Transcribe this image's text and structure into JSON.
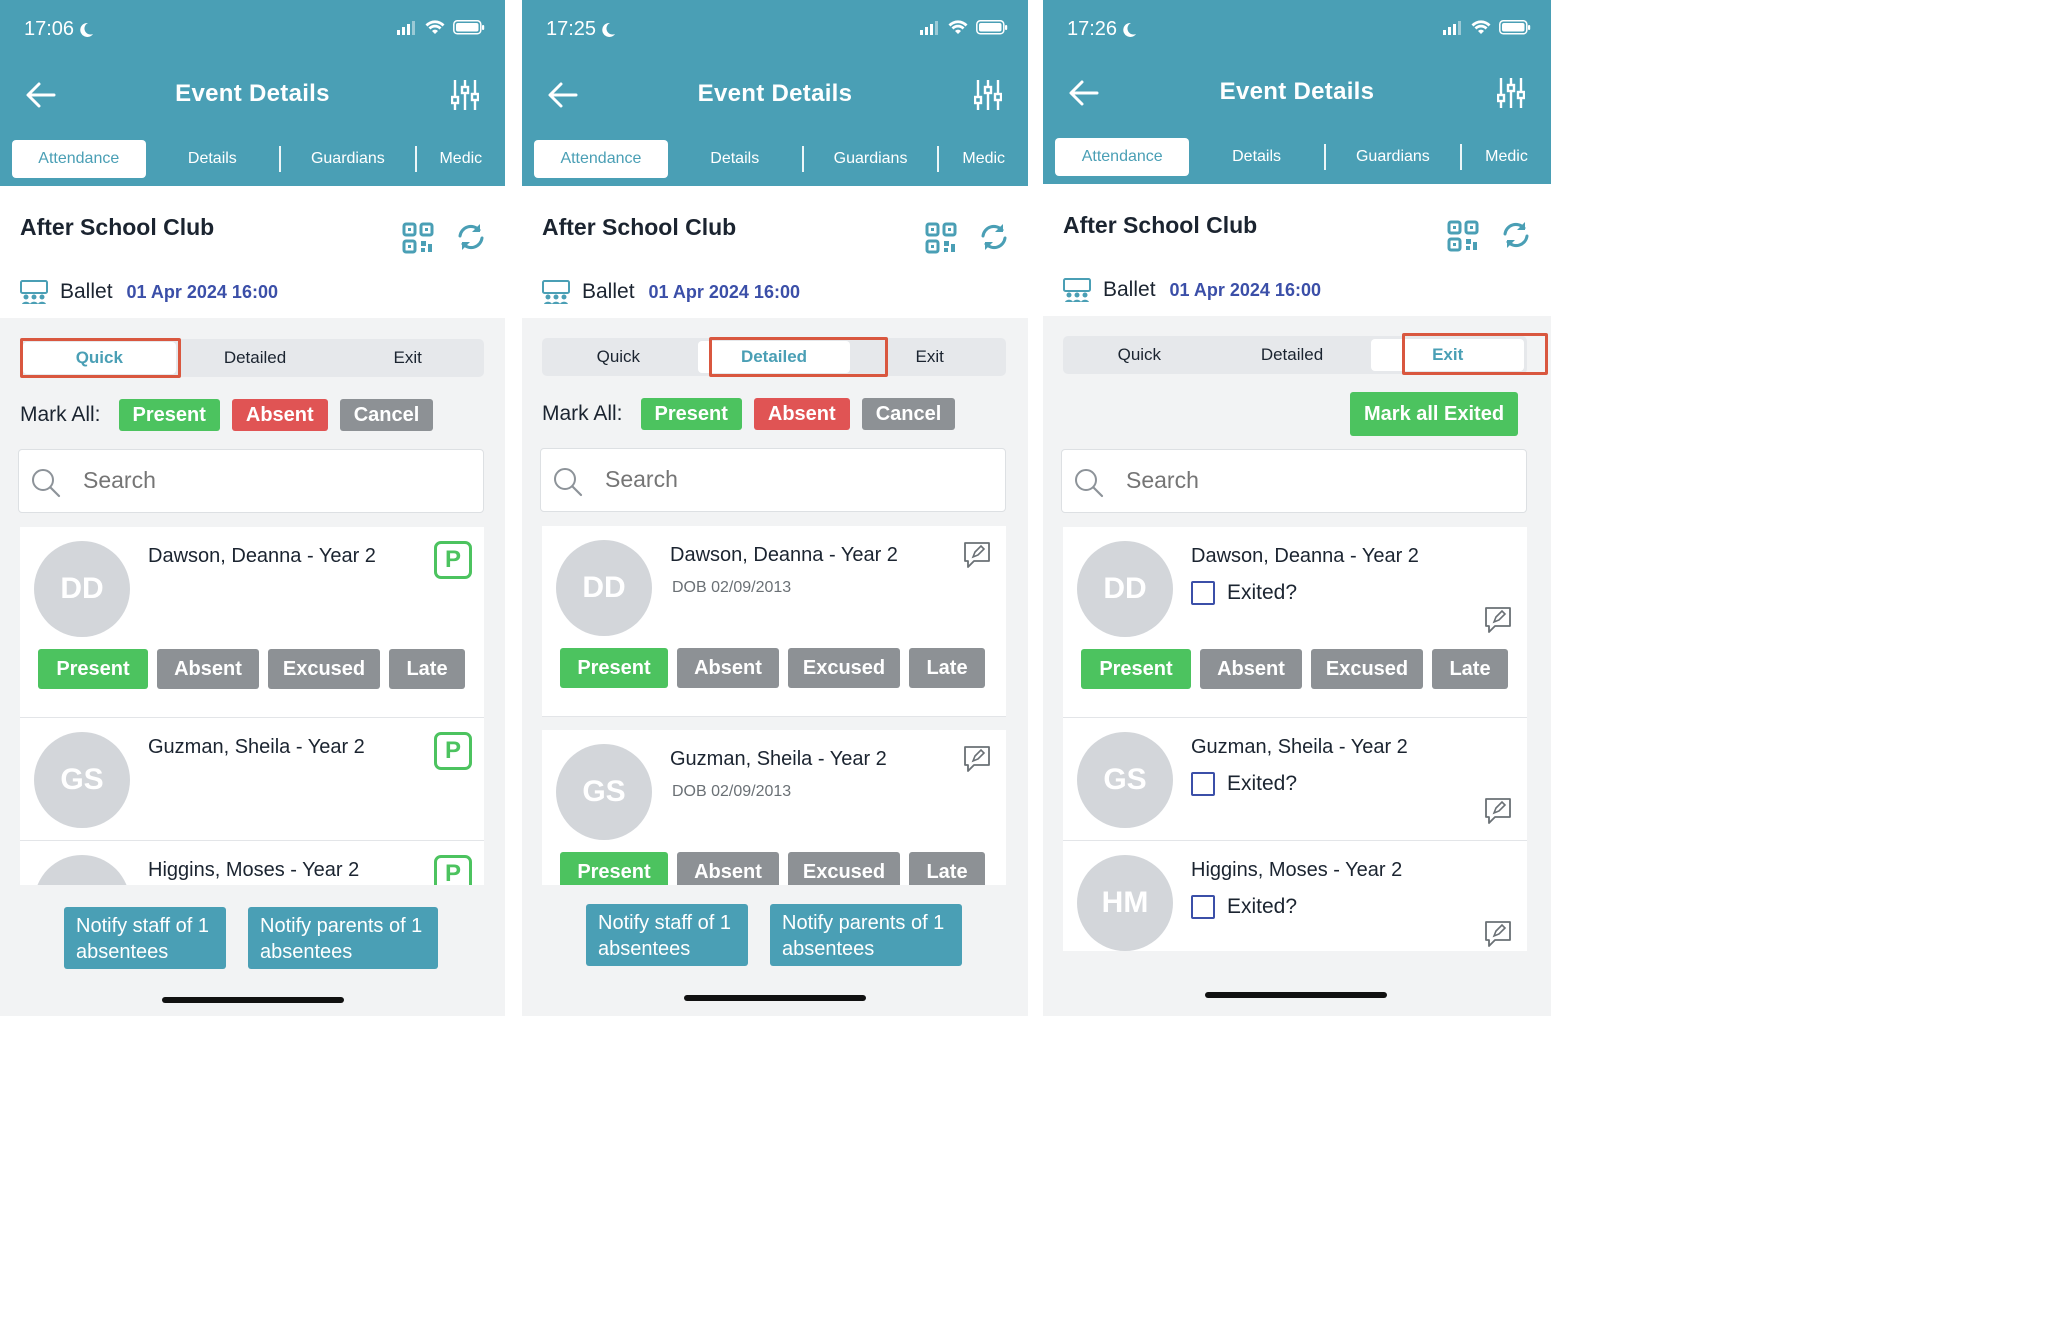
{
  "screens": [
    {
      "status_time": "17:06",
      "title": "Event Details",
      "tabs": [
        "Attendance",
        "Details",
        "Guardians",
        "Medic"
      ],
      "club_name": "After School Club",
      "activity": "Ballet",
      "datetime": "01 Apr 2024 16:00",
      "modes": [
        "Quick",
        "Detailed",
        "Exit"
      ],
      "mark_all_label": "Mark All:",
      "mark_all_buttons": [
        "Present",
        "Absent",
        "Cancel"
      ],
      "search_placeholder": "Search",
      "students": [
        {
          "initials": "DD",
          "name": "Dawson, Deanna - Year 2",
          "badge": "P",
          "buttons": [
            "Present",
            "Absent",
            "Excused",
            "Late"
          ]
        },
        {
          "initials": "GS",
          "name": "Guzman, Sheila - Year 2",
          "badge": "P"
        },
        {
          "initials": "",
          "name": "Higgins, Moses - Year 2",
          "badge": "P"
        }
      ],
      "notify_staff": "Notify staff of 1 absentees",
      "notify_parents": "Notify parents of 1 absentees"
    },
    {
      "status_time": "17:25",
      "title": "Event Details",
      "tabs": [
        "Attendance",
        "Details",
        "Guardians",
        "Medic"
      ],
      "club_name": "After School Club",
      "activity": "Ballet",
      "datetime": "01 Apr 2024 16:00",
      "modes": [
        "Quick",
        "Detailed",
        "Exit"
      ],
      "mark_all_label": "Mark All:",
      "mark_all_buttons": [
        "Present",
        "Absent",
        "Cancel"
      ],
      "search_placeholder": "Search",
      "students": [
        {
          "initials": "DD",
          "name": "Dawson, Deanna - Year 2",
          "dob": "DOB 02/09/2013",
          "buttons": [
            "Present",
            "Absent",
            "Excused",
            "Late"
          ]
        },
        {
          "initials": "GS",
          "name": "Guzman, Sheila - Year 2",
          "dob": "DOB 02/09/2013",
          "buttons": [
            "Present",
            "Absent",
            "Excused",
            "Late"
          ]
        }
      ],
      "notify_staff": "Notify staff of 1 absentees",
      "notify_parents": "Notify parents of 1 absentees"
    },
    {
      "status_time": "17:26",
      "title": "Event Details",
      "tabs": [
        "Attendance",
        "Details",
        "Guardians",
        "Medic"
      ],
      "club_name": "After School Club",
      "activity": "Ballet",
      "datetime": "01 Apr 2024 16:00",
      "modes": [
        "Quick",
        "Detailed",
        "Exit"
      ],
      "mark_all_exited": "Mark all Exited",
      "search_placeholder": "Search",
      "exited_label": "Exited?",
      "students": [
        {
          "initials": "DD",
          "name": "Dawson, Deanna - Year 2",
          "buttons": [
            "Present",
            "Absent",
            "Excused",
            "Late"
          ]
        },
        {
          "initials": "GS",
          "name": "Guzman, Sheila - Year 2"
        },
        {
          "initials": "HM",
          "name": "Higgins, Moses - Year 2"
        }
      ]
    }
  ],
  "colors": {
    "header": "#4a9fb5",
    "present": "#4cc35f",
    "absent": "#e05454",
    "neutral": "#8d9195",
    "date": "#3b4fa8",
    "highlight": "#d9573f"
  }
}
